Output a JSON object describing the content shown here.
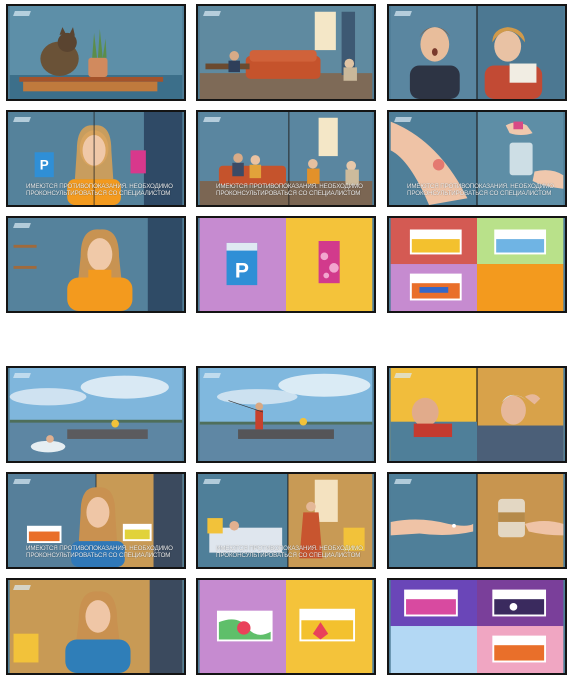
{
  "storyboard_top": {
    "disclaimer": "ИМЕЮТСЯ ПРОТИВОПОКАЗАНИЯ. НЕОБХОДИМО ПРОКОНСУЛЬТИРОВАТЬСЯ СО СПЕЦИАЛИСТОМ",
    "frames": [
      {
        "name": "frame-shelf-cat",
        "scene": "cat and cactus on a shelf"
      },
      {
        "name": "frame-living-room",
        "scene": "orange sofa in living room"
      },
      {
        "name": "frame-surprised-pair",
        "scene": "young man and older woman surprised"
      },
      {
        "name": "frame-woman-products",
        "scene": "woman holding two packs"
      },
      {
        "name": "frame-living-room-family",
        "scene": "family in living room"
      },
      {
        "name": "frame-arm-remedy",
        "scene": "arm with rash and glass of water"
      },
      {
        "name": "frame-woman-portrait",
        "scene": "woman in orange sweater"
      },
      {
        "name": "frame-packshot-pair",
        "scene": "two packs on purple and yellow"
      },
      {
        "name": "frame-packshot-grid",
        "scene": "packs on coloured tiles"
      }
    ]
  },
  "storyboard_bottom": {
    "disclaimer": "ИМЕЮТСЯ ПРОТИВОПОКАЗАНИЯ. НЕОБХОДИМО ПРОКОНСУЛЬТИРОВАТЬСЯ СО СПЕЦИАЛИСТОМ",
    "frames": [
      {
        "name": "frame-lake-splash",
        "scene": "swimmer near a boat on a lake"
      },
      {
        "name": "frame-lake-boat",
        "scene": "fishermen in a boat"
      },
      {
        "name": "frame-sick-men",
        "scene": "two men feeling unwell"
      },
      {
        "name": "frame-woman-packs-blue",
        "scene": "woman in blue holding packs"
      },
      {
        "name": "frame-bedroom-couple",
        "scene": "bedroom and woman by window"
      },
      {
        "name": "frame-hands-pills",
        "scene": "hands with pills and jar"
      },
      {
        "name": "frame-woman-blue-portrait",
        "scene": "woman in blue top"
      },
      {
        "name": "frame-packshot-swirl",
        "scene": "swirl packs on purple and yellow"
      },
      {
        "name": "frame-packshot-tiles",
        "scene": "packs on purple and blue tiles"
      }
    ]
  },
  "colors": {
    "wall_blue": "#4f7d96",
    "orange": "#f39a1e",
    "purple": "#c68bd0",
    "yellow": "#f4c33a",
    "sky": "#7fb6dc",
    "lake": "#5d86a3"
  },
  "packshot": {
    "brand_letter": "P"
  }
}
